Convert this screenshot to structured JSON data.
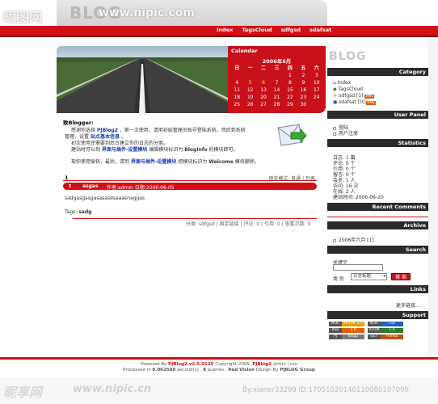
{
  "watermark": {
    "site_name": "昵图网",
    "url_top": "www.nipic.com",
    "bottom_site": "昵享网",
    "bottom_url": "www.nipic.cn",
    "bottom_id": "By:xianer33299 ID:17051020140110080107099"
  },
  "header": {
    "logo": "BLOG",
    "nav": [
      "Index",
      "TagsCloud",
      "sdfgsd",
      "sdafsat"
    ]
  },
  "calendar": {
    "title": "Calendar",
    "month": "2006年6月",
    "weekdays": [
      "日",
      "一",
      "二",
      "三",
      "四",
      "五",
      "六"
    ],
    "days": [
      "",
      "",
      "",
      "",
      "1",
      "2",
      "3",
      "4",
      "5",
      "6",
      "7",
      "8",
      "9",
      "10",
      "11",
      "12",
      "13",
      "14",
      "15",
      "16",
      "17",
      "18",
      "19",
      "20",
      "21",
      "22",
      "23",
      "24",
      "25",
      "26",
      "27",
      "28",
      "29",
      "30",
      ""
    ],
    "linked_days": [
      "5",
      "6"
    ]
  },
  "welcome": {
    "title": "致Blogger:",
    "line1_a": "感谢你选择",
    "line1_link": "PJBlog2",
    "line1_b": "，第一次使用，请用初始管理员账号登陆系统，然后到系统",
    "line2_a": "管理，设置",
    "line2_link": "站点基本信息",
    "line2_b": "。",
    "line3": "初次使用还需要到后台建立你的日志的分类。",
    "line4_a": "建站时可以到",
    "line4_link": "界面与插件-设置模块",
    "line4_b": "编辑模块标识为",
    "line4_c": "BlogInfo",
    "line4_d": "的模块即可。",
    "line5_a": "现你使用愉快，最后，请到",
    "line5_link": "界面与插件-设置模块",
    "line5_b": "把模块标识为",
    "line5_c": "Welcome",
    "line5_d": "模块删除。"
  },
  "post": {
    "number": "1",
    "mode": "预览模式: 普通 | 列表",
    "title": "asgas",
    "meta": "作者:admin  日期:2006-06-05",
    "body": "sadgasgasgasasasdsaaasnaggas",
    "tags_label": "Tags:",
    "tags_value": "sadg",
    "footer": "分类: sdfgsd | 固定链接 | 评论: 0 | 引用: 0 | 查看次数: 0"
  },
  "sidebar": {
    "logo": "BLOG",
    "category": {
      "title": "Category",
      "items": [
        {
          "label": "Index",
          "count": ""
        },
        {
          "label": "TagsCloud",
          "count": ""
        },
        {
          "label": "sdfgsd",
          "count": "[1]"
        },
        {
          "label": "sdafsat",
          "count": "[0]"
        }
      ]
    },
    "user_panel": {
      "title": "User Panel",
      "items": [
        "登陆",
        "用户注册"
      ]
    },
    "statistics": {
      "title": "Statistics",
      "rows": [
        "日志: 1 篇",
        "评论: 0 个",
        "引用: 0 个",
        "留言: 0 个",
        "会员: 1 人",
        "访问: 16 次",
        "在线: 2 人",
        "建站时间: 2006-06-20"
      ]
    },
    "recent_comments": {
      "title": "Recent Comments"
    },
    "archive": {
      "title": "Archive",
      "items": [
        "2006年六月 [1]"
      ]
    },
    "search": {
      "title": "Search",
      "keyword_label": "关键字",
      "type_label": "类 别",
      "select_value": "日志标题",
      "button": "搜 索"
    },
    "links": {
      "title": "Links",
      "more": "更多链接..."
    },
    "support": {
      "title": "Support",
      "badges": [
        {
          "left": "W3C",
          "right": "XHTML 1.0",
          "color": "#d9a300"
        },
        {
          "left": "W3C",
          "right": "CSS",
          "color": "#2060c0"
        },
        {
          "left": "RSS",
          "right": "2.0",
          "color": "#e06000"
        },
        {
          "left": "ATOM",
          "right": "1.0",
          "color": "#2c7a2c"
        },
        {
          "left": "PJ",
          "right": "Blog2",
          "color": "#777777"
        },
        {
          "left": "GET",
          "right": "Firefox",
          "color": "#c05010"
        }
      ]
    }
  },
  "footer": {
    "line1_a": "Powered By",
    "line1_b": "PJBlog2 v2.5.0125",
    "line1_c": "Copyright 2005,",
    "line1_d": "PJBlog2",
    "line1_e": "xhtml | css",
    "line2_a": "Processed in",
    "line2_b": "0.062500",
    "line2_c": "second(s) ,",
    "line2_d": "8",
    "line2_e": "queries ,",
    "line2_f": "Red Vision",
    "line2_g": "Design By",
    "line2_h": "PJBLOG Group"
  },
  "colors": {
    "accent_red": "#d21016",
    "dark_head": "#2b2b2b"
  }
}
